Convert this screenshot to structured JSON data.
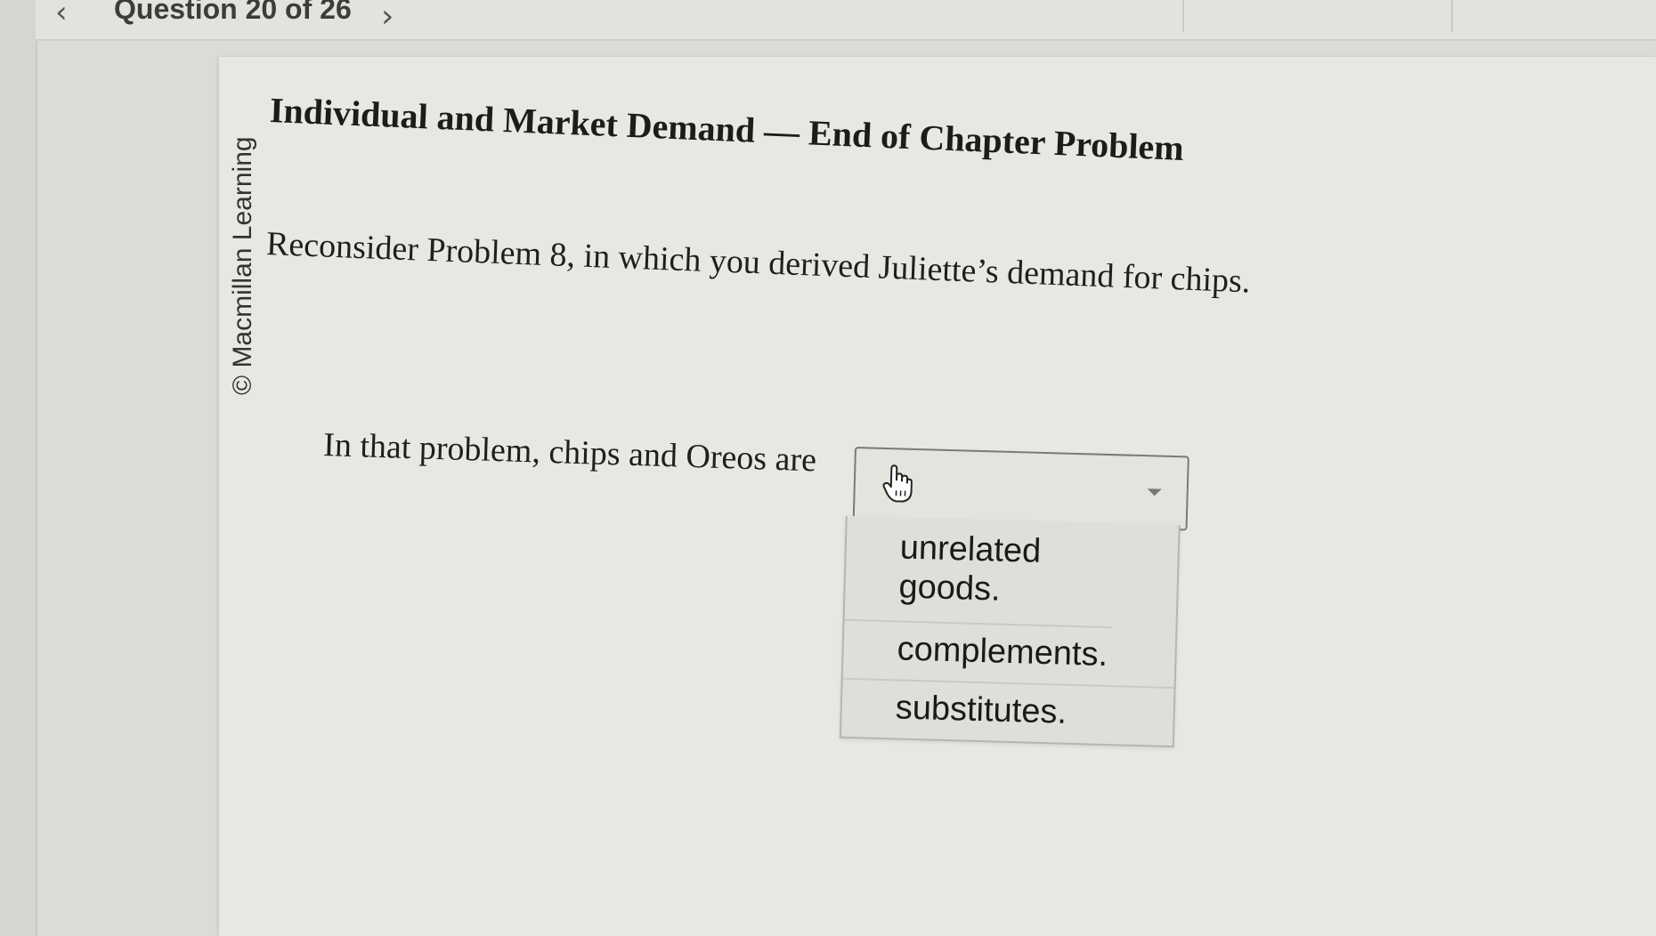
{
  "header": {
    "prev_icon": "chevron-left-icon",
    "question_counter": "Question 20 of 26",
    "next_icon": "chevron-right-icon"
  },
  "copyright": "© Macmillan Learning",
  "problem": {
    "title": "Individual and Market Demand — End of Chapter Problem",
    "statement": "Reconsider Problem 8, in which you derived Juliette’s demand for chips.",
    "question_text": "In that problem, chips and Oreos are"
  },
  "dropdown": {
    "selected_value": "",
    "cursor_icon": "hand-cursor-icon",
    "options": [
      "unrelated goods.",
      "complements.",
      "substitutes."
    ]
  },
  "colors": {
    "page_background": "#e8e8e2",
    "text": "#1f1f1f",
    "dropdown_border": "#7a7a7a"
  }
}
